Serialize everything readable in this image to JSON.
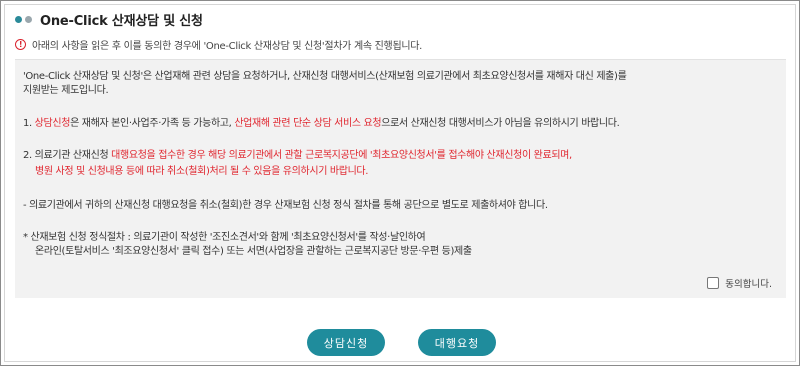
{
  "header": {
    "title": "One-Click 산재상담 및 신청",
    "dot_colors": [
      "#2a8a99",
      "#9aa7ad"
    ]
  },
  "notice": {
    "icon": "alert-circle-icon",
    "text": "아래의 사항을 읽은 후 이를 동의한 경우에 'One-Click 산재상담 및 신청'절차가 계속 진행됩니다."
  },
  "content": {
    "intro_line1": "'One-Click 산재상담 및 신청'은 산업재해 관련 상담을 요청하거나, 산재신청 대행서비스(산재보험 의료기관에서 최초요양신청서를 재해자 대신 제출)를",
    "intro_line2": "지원받는 제도입니다.",
    "item1": {
      "num": "1. ",
      "red1": "상담신청",
      "text1": "은 재해자 본인·사업주·가족 등 가능하고, ",
      "red2": "산업재해 관련 단순 상담 서비스 요청",
      "text2": "으로서 산재신청 대행서비스가 아님을 유의하시기 바랍니다."
    },
    "item2": {
      "prefix": "2. 의료기관 산재신청 ",
      "red1": "대행요청을 접수한 경우 해당 의료기관에서 관할 근로복지공단에 '최초요양신청서'를 접수해야 산재신청이 완료되며,",
      "red2": "병원 사정 및 신청내용 등에 따라 취소(철회)처리 될 수 있음을 유의하시기 바랍니다."
    },
    "item3": "- 의료기관에서 귀하의 산재신청 대행요청을 취소(철회)한 경우 산재보험 신청 정식 절차를 통해 공단으로 별도로 제출하셔야 합니다.",
    "item4_line1": "* 산재보험 신청 정식절차 : 의료기관이 작성한 '조진소견서'와 함께 '최초요양신청서'를 작성·날인하여",
    "item4_line2": "온라인(토탈서비스 '최조요양신청서' 클릭 접수) 또는 서면(사업장을 관할하는 근로복지공단 방문·우편 등)제출"
  },
  "agree": {
    "checked": false,
    "label": "동의합니다."
  },
  "buttons": {
    "consult": "상담신청",
    "agency": "대행요청",
    "color": "#1f8c9c"
  }
}
